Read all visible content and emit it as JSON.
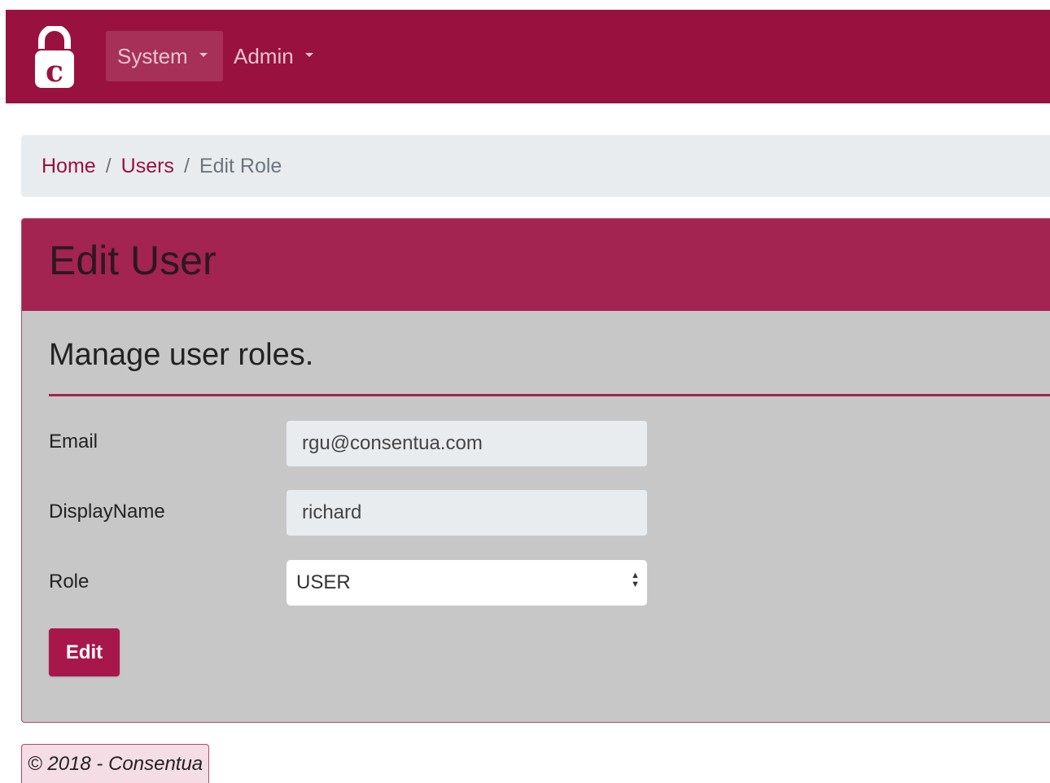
{
  "navbar": {
    "logo_alt": "Consentua logo",
    "items": [
      {
        "label": "System"
      },
      {
        "label": "Admin"
      }
    ]
  },
  "breadcrumb": {
    "home": "Home",
    "users": "Users",
    "current": "Edit Role",
    "separator": "/"
  },
  "card": {
    "title": "Edit User",
    "subtitle": "Manage user roles.",
    "fields": {
      "email": {
        "label": "Email",
        "value": "rgu@consentua.com"
      },
      "display_name": {
        "label": "DisplayName",
        "value": "richard"
      },
      "role": {
        "label": "Role",
        "value": "USER"
      }
    },
    "submit_label": "Edit"
  },
  "footer": {
    "text": "© 2018 - Consentua"
  },
  "colors": {
    "brand": "#99123f",
    "card_header": "#a32450",
    "card_body": "#c7c7c7",
    "breadcrumb_bg": "#e9ecef"
  },
  "icons": {
    "logo": "padlock-c-logo",
    "dropdown": "caret-down-icon",
    "select": "select-arrows-icon"
  }
}
